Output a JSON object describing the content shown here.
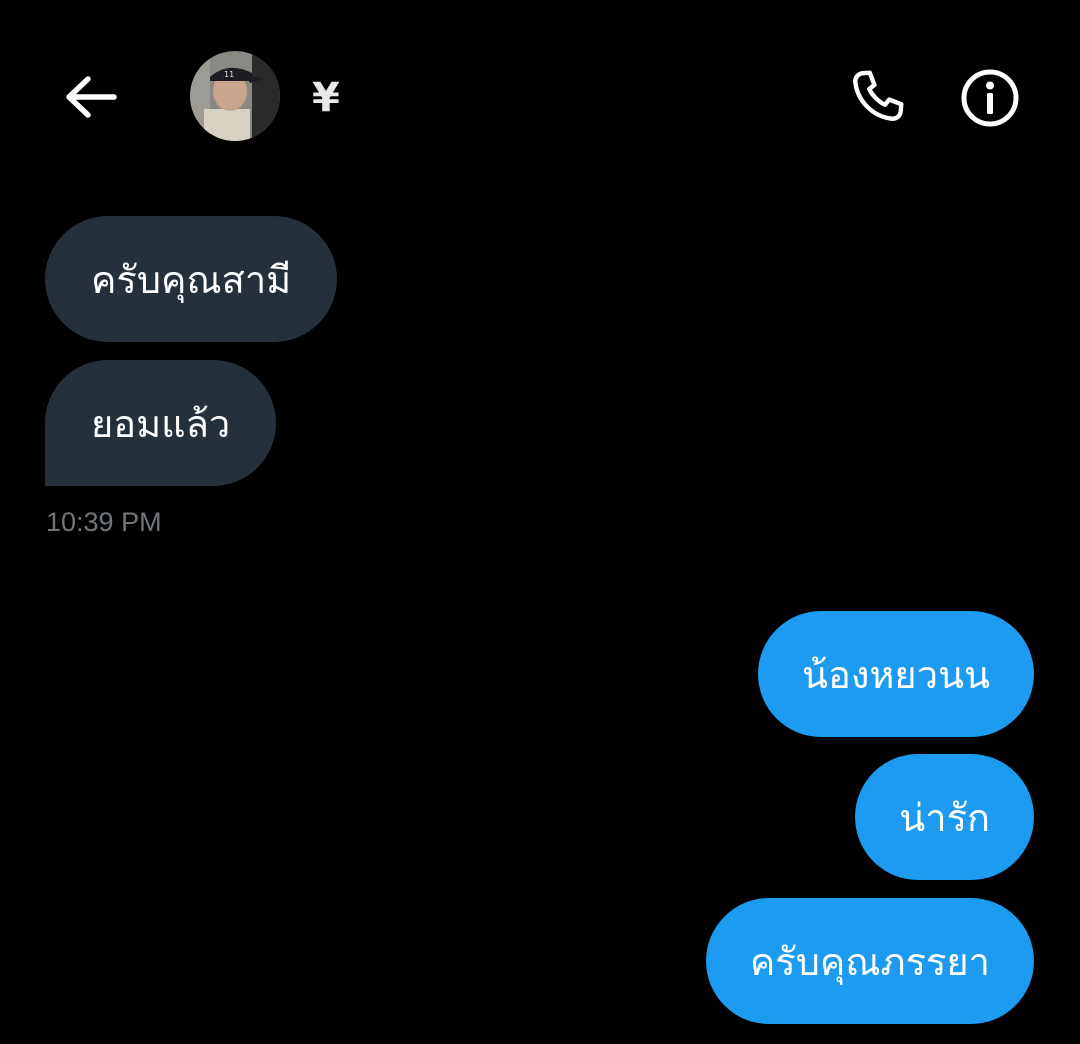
{
  "header": {
    "back_icon": "arrow-left-icon",
    "contact_name": "¥",
    "call_icon": "phone-icon",
    "info_icon": "info-circle-icon"
  },
  "messages": {
    "received": [
      {
        "text": "ครับคุณสามี"
      },
      {
        "text": "ยอมแล้ว"
      }
    ],
    "received_timestamp": "10:39 PM",
    "sent": [
      {
        "text": "น้องหยวนน"
      },
      {
        "text": "น่ารัก"
      },
      {
        "text": "ครับคุณภรรยา"
      }
    ]
  },
  "colors": {
    "background": "#000000",
    "received_bubble": "#25303a",
    "sent_bubble": "#1d9bf0",
    "timestamp": "#71767b",
    "text": "#ffffff"
  }
}
